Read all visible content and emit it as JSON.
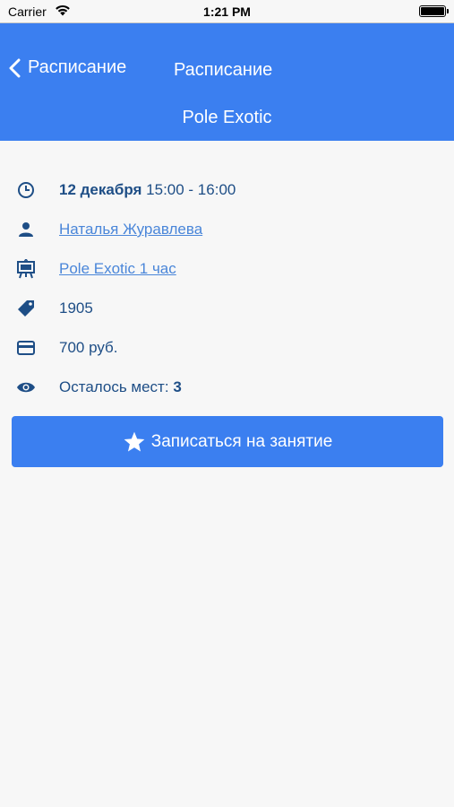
{
  "status_bar": {
    "carrier": "Carrier",
    "time": "1:21 PM"
  },
  "navbar": {
    "back_label": "Расписание",
    "title": "Расписание",
    "subtitle": "Pole Exotic"
  },
  "info": {
    "date": "12 декабря",
    "time_range": "15:00 - 16:00",
    "instructor": "Наталья Журавлева",
    "class_name": "Pole Exotic 1 час",
    "code": "1905",
    "price": "700 руб.",
    "seats_label": "Осталось мест:",
    "seats_count": "3"
  },
  "signup_button": {
    "label": "Записаться на занятие"
  },
  "colors": {
    "primary": "#3b7ff0",
    "icon": "#1e4e86",
    "link": "#4a86d9",
    "background": "#f7f7f7"
  },
  "icons": [
    "wifi-icon",
    "battery-icon",
    "chevron-left-icon",
    "clock-icon",
    "person-icon",
    "easel-icon",
    "tag-icon",
    "credit-card-icon",
    "eye-icon",
    "star-icon"
  ]
}
